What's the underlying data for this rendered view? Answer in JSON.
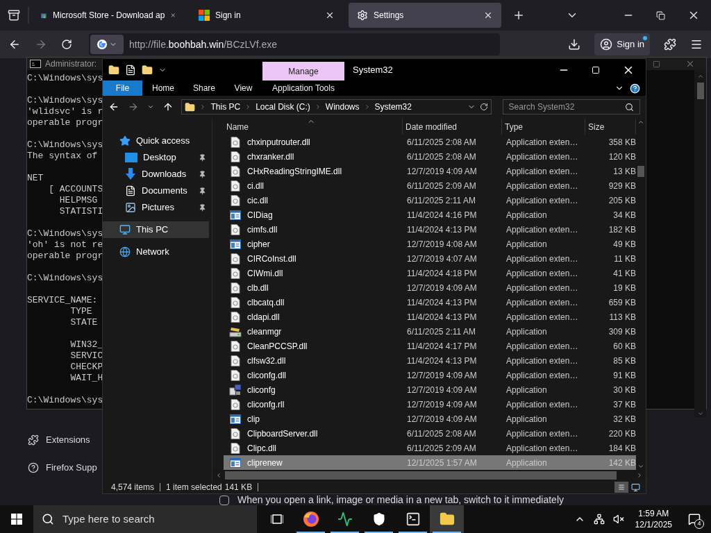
{
  "browser": {
    "tabs": [
      {
        "title": "Microsoft Store - Download ap",
        "selected": false
      },
      {
        "title": "Sign in",
        "selected": false
      },
      {
        "title": "Settings",
        "selected": true
      }
    ],
    "url": {
      "before": "http://file.",
      "domain": "boohbah.win",
      "after": "/BCzLVf.exe"
    },
    "account_label": "Sign in",
    "sidebar": [
      {
        "label": "Extensions"
      },
      {
        "label": "Firefox Supp"
      }
    ],
    "option": {
      "label": "When you open a link, image or media in a new tab, switch to it immediately",
      "checked": false
    }
  },
  "console": {
    "title": "Administrator:",
    "blocks": [
      [
        "C:\\Windows\\sys"
      ],
      [
        "C:\\Windows\\sys",
        "'wlidsvc' is r",
        "operable progr"
      ],
      [
        "C:\\Windows\\sys",
        "The syntax of"
      ],
      [
        "NET",
        "    [ ACCOUNTS",
        "      HELPMSG",
        "      STATISTI"
      ],
      [
        "C:\\Windows\\sys",
        "'oh' is not re",
        "operable progr"
      ],
      [
        "C:\\Windows\\sys"
      ],
      [
        "SERVICE_NAME:",
        "        TYPE",
        "        STATE"
      ],
      [
        "        WIN32_",
        "        SERVIC",
        "        CHECKP",
        "        WAIT_H"
      ],
      [
        "C:\\Windows\\sys"
      ]
    ]
  },
  "explorer": {
    "context_tab": "Manage",
    "title": "System32",
    "ribbon_tabs": [
      {
        "label": "File",
        "kind": "file"
      },
      {
        "label": "Home",
        "kind": "tab"
      },
      {
        "label": "Share",
        "kind": "tab"
      },
      {
        "label": "View",
        "kind": "tab"
      },
      {
        "label": "Application Tools",
        "kind": "tab"
      }
    ],
    "breadcrumbs": [
      "This PC",
      "Local Disk (C:)",
      "Windows",
      "System32"
    ],
    "search_placeholder": "Search System32",
    "navigation": [
      {
        "label": "Quick access",
        "pinned": false,
        "selected": false,
        "children": [
          {
            "label": "Desktop",
            "pinned": true,
            "selected": false
          },
          {
            "label": "Downloads",
            "pinned": true,
            "selected": false
          },
          {
            "label": "Documents",
            "pinned": true,
            "selected": false
          },
          {
            "label": "Pictures",
            "pinned": true,
            "selected": false
          }
        ]
      },
      {
        "label": "This PC",
        "pinned": false,
        "selected": true
      },
      {
        "label": "Network",
        "pinned": false,
        "selected": false
      }
    ],
    "columns": [
      "Name",
      "Date modified",
      "Type",
      "Size"
    ],
    "rows": [
      {
        "name": "chxinputrouter.dll",
        "date": "6/11/2025 2:08 AM",
        "type": "Application exten…",
        "size": "358 KB",
        "kind": "library",
        "selected": false
      },
      {
        "name": "chxranker.dll",
        "date": "6/11/2025 2:08 AM",
        "type": "Application exten…",
        "size": "120 KB",
        "kind": "library",
        "selected": false
      },
      {
        "name": "CHxReadingStringIME.dll",
        "date": "12/7/2019 4:09 AM",
        "type": "Application exten…",
        "size": "13 KB",
        "kind": "library",
        "selected": false
      },
      {
        "name": "ci.dll",
        "date": "6/11/2025 2:09 AM",
        "type": "Application exten…",
        "size": "929 KB",
        "kind": "library",
        "selected": false
      },
      {
        "name": "cic.dll",
        "date": "6/11/2025 2:11 AM",
        "type": "Application exten…",
        "size": "205 KB",
        "kind": "library",
        "selected": false
      },
      {
        "name": "CIDiag",
        "date": "11/4/2024 4:16 PM",
        "type": "Application",
        "size": "34 KB",
        "kind": "application",
        "selected": false
      },
      {
        "name": "cimfs.dll",
        "date": "11/4/2024 4:13 PM",
        "type": "Application exten…",
        "size": "182 KB",
        "kind": "library",
        "selected": false
      },
      {
        "name": "cipher",
        "date": "12/7/2019 4:08 AM",
        "type": "Application",
        "size": "49 KB",
        "kind": "application",
        "selected": false
      },
      {
        "name": "CIRCoInst.dll",
        "date": "12/7/2019 4:07 AM",
        "type": "Application exten…",
        "size": "11 KB",
        "kind": "library",
        "selected": false
      },
      {
        "name": "CIWmi.dll",
        "date": "11/4/2024 4:18 PM",
        "type": "Application exten…",
        "size": "41 KB",
        "kind": "library",
        "selected": false
      },
      {
        "name": "clb.dll",
        "date": "12/7/2019 4:09 AM",
        "type": "Application exten…",
        "size": "19 KB",
        "kind": "library",
        "selected": false
      },
      {
        "name": "clbcatq.dll",
        "date": "11/4/2024 4:13 PM",
        "type": "Application exten…",
        "size": "659 KB",
        "kind": "library",
        "selected": false
      },
      {
        "name": "cldapi.dll",
        "date": "11/4/2024 4:13 PM",
        "type": "Application exten…",
        "size": "113 KB",
        "kind": "library",
        "selected": false
      },
      {
        "name": "cleanmgr",
        "date": "6/11/2025 2:11 AM",
        "type": "Application",
        "size": "309 KB",
        "kind": "cleanup",
        "selected": false
      },
      {
        "name": "CleanPCCSP.dll",
        "date": "11/4/2024 4:17 PM",
        "type": "Application exten…",
        "size": "60 KB",
        "kind": "library",
        "selected": false
      },
      {
        "name": "clfsw32.dll",
        "date": "11/4/2024 4:13 PM",
        "type": "Application exten…",
        "size": "85 KB",
        "kind": "library",
        "selected": false
      },
      {
        "name": "cliconfg.dll",
        "date": "12/7/2019 4:09 AM",
        "type": "Application exten…",
        "size": "91 KB",
        "kind": "library",
        "selected": false
      },
      {
        "name": "cliconfg",
        "date": "12/7/2019 4:09 AM",
        "type": "Application",
        "size": "30 KB",
        "kind": "config",
        "selected": false
      },
      {
        "name": "cliconfg.rll",
        "date": "12/7/2019 4:09 AM",
        "type": "Application exten…",
        "size": "37 KB",
        "kind": "library",
        "selected": false
      },
      {
        "name": "clip",
        "date": "12/7/2019 4:09 AM",
        "type": "Application",
        "size": "32 KB",
        "kind": "application",
        "selected": false
      },
      {
        "name": "ClipboardServer.dll",
        "date": "6/11/2025 2:08 AM",
        "type": "Application exten…",
        "size": "220 KB",
        "kind": "library",
        "selected": false
      },
      {
        "name": "Clipc.dll",
        "date": "6/11/2025 2:09 AM",
        "type": "Application exten…",
        "size": "184 KB",
        "kind": "library",
        "selected": false
      },
      {
        "name": "cliprenew",
        "date": "12/1/2025 1:57 AM",
        "type": "Application",
        "size": "142 KB",
        "kind": "application",
        "selected": true
      }
    ],
    "status": {
      "items": "4,574 items",
      "selection": "1 item selected",
      "size": "141 KB"
    }
  },
  "taskbar": {
    "search_placeholder": "Type here to search",
    "apps": [
      {
        "kind": "taskview",
        "running": false,
        "active": false
      },
      {
        "kind": "browser",
        "running": true,
        "active": false
      },
      {
        "kind": "monitor",
        "running": true,
        "active": false
      },
      {
        "kind": "security",
        "running": true,
        "active": false
      },
      {
        "kind": "console",
        "running": true,
        "active": false
      },
      {
        "kind": "files",
        "running": true,
        "active": true
      }
    ],
    "time": "1:59 AM",
    "date": "12/1/2025",
    "notifications": "4"
  }
}
